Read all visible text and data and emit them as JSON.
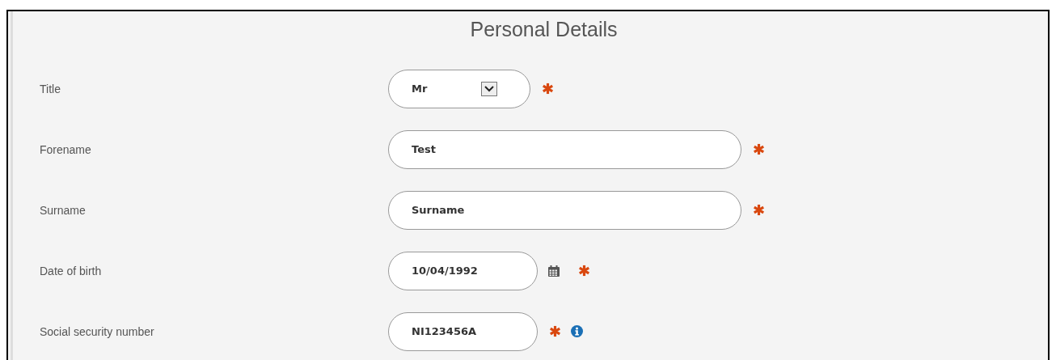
{
  "section": {
    "title": "Personal Details"
  },
  "fields": [
    {
      "label": "Title",
      "kind": "select",
      "value": "Mr",
      "required": true,
      "info": false
    },
    {
      "label": "Forename",
      "kind": "text",
      "value": "Test",
      "required": true,
      "info": false
    },
    {
      "label": "Surname",
      "kind": "text",
      "value": "Surname",
      "required": true,
      "info": false
    },
    {
      "label": "Date of birth",
      "kind": "date",
      "value": "10/04/1992",
      "required": true,
      "info": false
    },
    {
      "label": "Social security number",
      "kind": "code",
      "value": "NI123456A",
      "required": true,
      "info": true
    }
  ]
}
